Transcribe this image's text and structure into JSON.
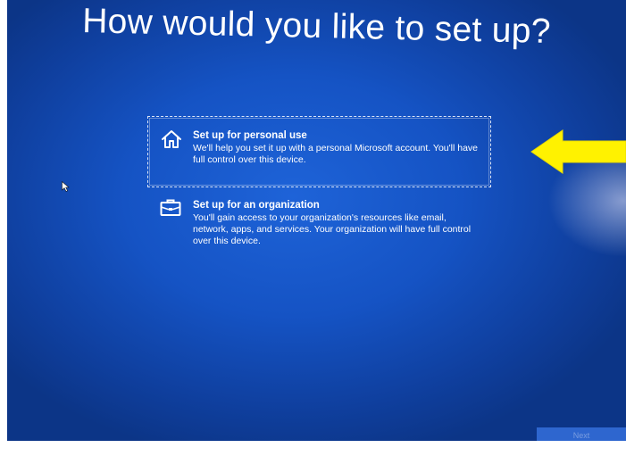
{
  "header": {
    "title": "How would you like to set up?"
  },
  "options": [
    {
      "title": "Set up for personal use",
      "description": "We'll help you set it up with a personal Microsoft account. You'll have full control over this device.",
      "icon": "home-icon",
      "selected": true
    },
    {
      "title": "Set up for an organization",
      "description": "You'll gain access to your organization's resources like email, network, apps, and services. Your organization will have full control over this device.",
      "icon": "briefcase-icon",
      "selected": false
    }
  ],
  "footer": {
    "next_label": "Next"
  },
  "colors": {
    "background": "#1553c4",
    "text": "#ffffff",
    "annotation_arrow": "#fff200"
  }
}
